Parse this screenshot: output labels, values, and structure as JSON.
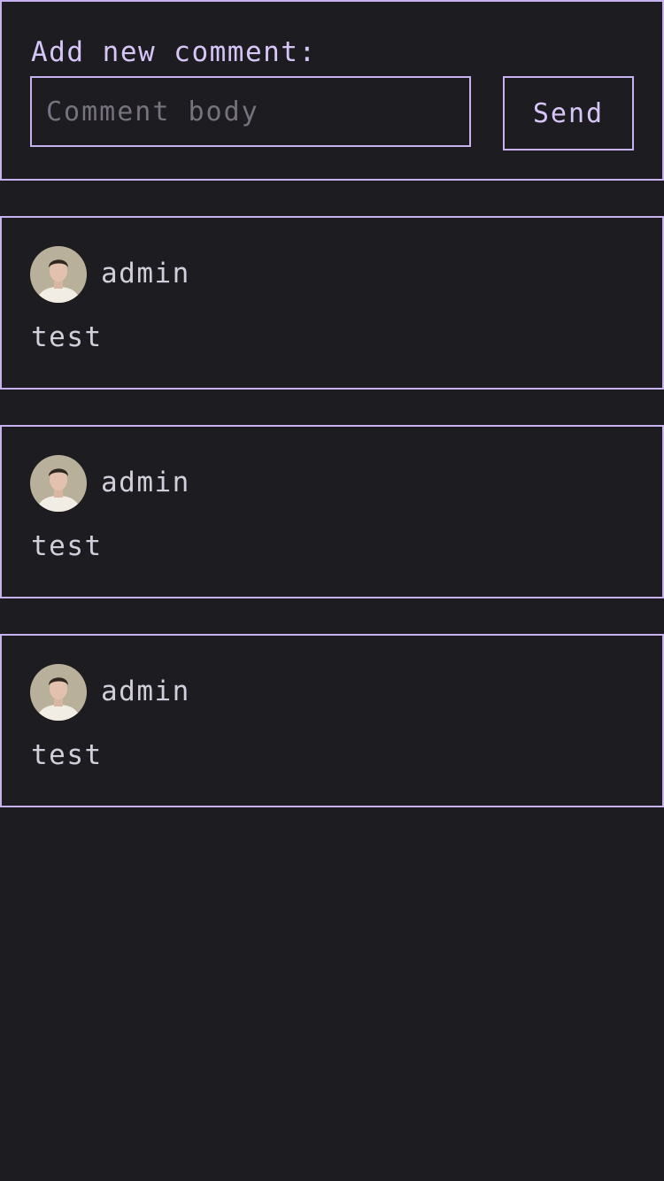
{
  "composer": {
    "label": "Add new comment:",
    "input_placeholder": "Comment body",
    "input_value": "",
    "send_label": "Send"
  },
  "comments": [
    {
      "author": "admin",
      "body": "test"
    },
    {
      "author": "admin",
      "body": "test"
    },
    {
      "author": "admin",
      "body": "test"
    }
  ],
  "colors": {
    "background": "#1d1c21",
    "border_accent": "#c7b2f0",
    "text": "#d2cdda",
    "placeholder": "#76727e"
  }
}
